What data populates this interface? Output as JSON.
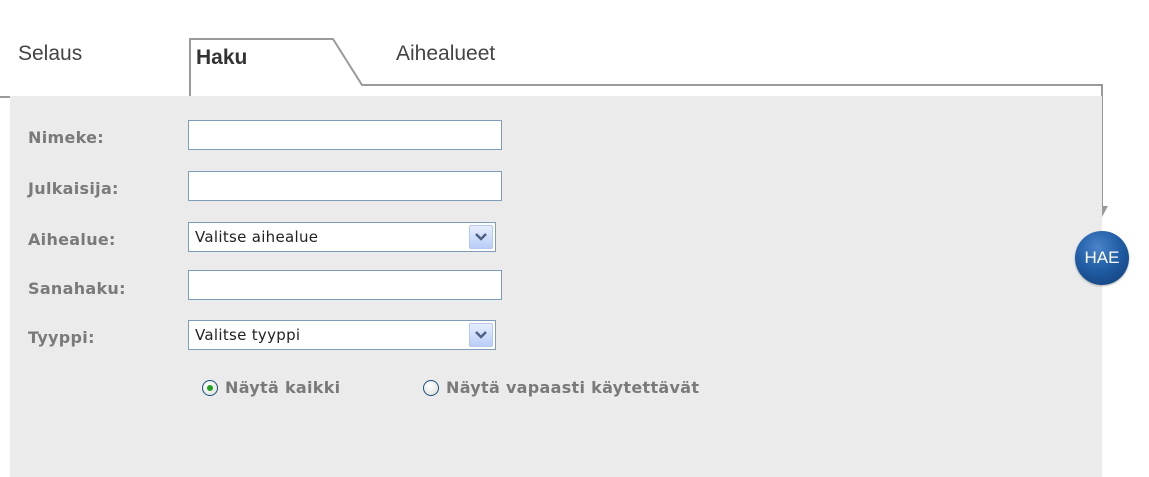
{
  "tabs": {
    "selaus": "Selaus",
    "haku": "Haku",
    "aihealueet": "Aihealueet"
  },
  "form": {
    "nimeke": {
      "label": "Nimeke:",
      "value": ""
    },
    "julkaisija": {
      "label": "Julkaisija:",
      "value": ""
    },
    "aihealue": {
      "label": "Aihealue:",
      "selected": "Valitse aihealue"
    },
    "sanahaku": {
      "label": "Sanahaku:",
      "value": ""
    },
    "tyyppi": {
      "label": "Tyyppi:",
      "selected": "Valitse tyyppi"
    }
  },
  "filter": {
    "show_all": "Näytä kaikki",
    "show_free": "Näytä vapaasti käytettävät",
    "selected": "show_all"
  },
  "search_button": {
    "label": "HAE"
  },
  "colors": {
    "panel_bg": "#ebebeb",
    "label": "#7a7a7a",
    "button_blue": "#215ea6",
    "radio_checked": "#21a121",
    "input_border": "#7f9db9"
  },
  "icons": {
    "select_arrow": "chevron-down-icon",
    "connector_arrow": "arrow-down-icon"
  }
}
